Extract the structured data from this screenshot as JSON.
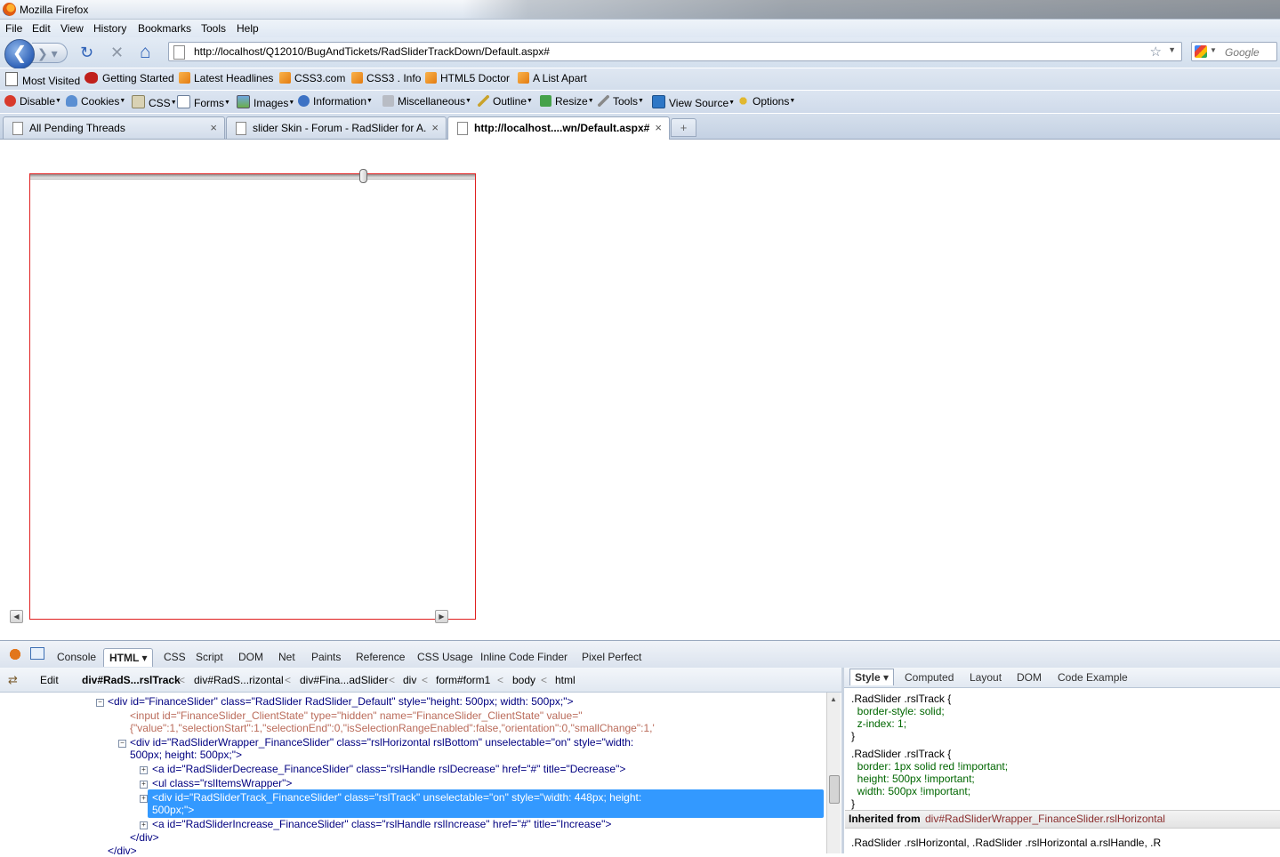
{
  "window": {
    "title": "Mozilla Firefox"
  },
  "menubar": [
    "File",
    "Edit",
    "View",
    "History",
    "Bookmarks",
    "Tools",
    "Help"
  ],
  "navbar": {
    "url": "http://localhost/Q12010/BugAndTickets/RadSliderTrackDown/Default.aspx#",
    "search_placeholder": "Google"
  },
  "bookmarks": [
    "Most Visited",
    "Getting Started",
    "Latest Headlines",
    "CSS3.com",
    "CSS3 . Info",
    "HTML5 Doctor",
    "A List Apart"
  ],
  "webdev": [
    "Disable",
    "Cookies",
    "CSS",
    "Forms",
    "Images",
    "Information",
    "Miscellaneous",
    "Outline",
    "Resize",
    "Tools",
    "View Source",
    "Options"
  ],
  "tabs": [
    {
      "label": "All Pending Threads"
    },
    {
      "label": "slider Skin - Forum - RadSlider for A..."
    },
    {
      "label": "http://localhost....wn/Default.aspx#"
    }
  ],
  "icons": {
    "close": "×",
    "new_tab": "+",
    "star": "☆",
    "back": "❮",
    "forward": "❯",
    "reload": "↻",
    "stop": "✕",
    "home": "⌂",
    "left_arrow": "◀",
    "right_arrow": "▶"
  },
  "firebug": {
    "tabs": [
      "Console",
      "HTML ▾",
      "CSS",
      "Script",
      "DOM",
      "Net",
      "Paints",
      "Reference",
      "CSS Usage",
      "Inline Code Finder",
      "Pixel Perfect"
    ],
    "edit_label": "Edit",
    "breadcrumbs": [
      "div#RadS...rslTrack",
      "div#RadS...rizontal",
      "div#Fina...adSlider",
      "div",
      "form#form1",
      "body",
      "html"
    ],
    "right_tabs": [
      "Style ▾",
      "Computed",
      "Layout",
      "DOM",
      "Code Example"
    ],
    "html_lines": [
      "<div id=\"FinanceSlider\" class=\"RadSlider RadSlider_Default\" style=\"height: 500px; width: 500px;\">",
      "<input id=\"FinanceSlider_ClientState\" type=\"hidden\" name=\"FinanceSlider_ClientState\" value=\"",
      "{\"value\":1,\"selectionStart\":1,\"selectionEnd\":0,\"isSelectionRangeEnabled\":false,\"orientation\":0,\"smallChange\":1,'",
      "<div id=\"RadSliderWrapper_FinanceSlider\" class=\"rslHorizontal rslBottom\" unselectable=\"on\" style=\"width:",
      "500px; height: 500px;\">",
      "<a id=\"RadSliderDecrease_FinanceSlider\" class=\"rslHandle rslDecrease\" href=\"#\" title=\"Decrease\">",
      "<ul class=\"rslItemsWrapper\">",
      "<div id=\"RadSliderTrack_FinanceSlider\" class=\"rslTrack\" unselectable=\"on\" style=\"width: 448px; height:",
      "500px;\">",
      "<a id=\"RadSliderIncrease_FinanceSlider\" class=\"rslHandle rslIncrease\" href=\"#\" title=\"Increase\">",
      "</div>",
      "</div>"
    ],
    "css_lines": [
      ".RadSlider .rslTrack {",
      "  border-style: solid;",
      "  z-index: 1;",
      "}",
      ".RadSlider .rslTrack {",
      "  border: 1px solid red !important;",
      "  height: 500px !important;",
      "  width: 500px !important;",
      "}"
    ],
    "inherited_label": "Inherited from",
    "inherited_selector": "div#RadSliderWrapper_FinanceSlider.rslHorizontal",
    "css_bottom_line": ".RadSlider .rslHorizontal, .RadSlider .rslHorizontal a.rslHandle, .R"
  }
}
